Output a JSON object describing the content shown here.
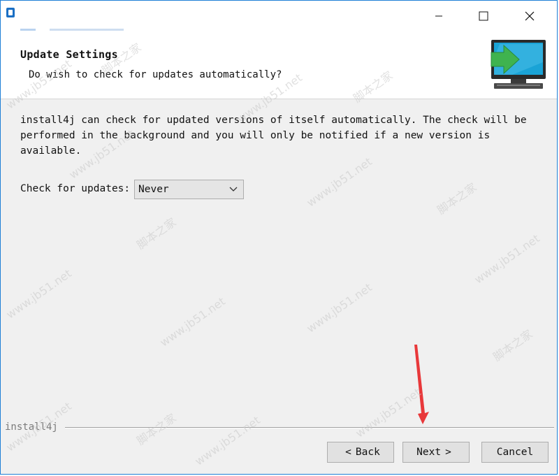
{
  "window": {
    "controls": {
      "minimize_icon": "minimize-icon",
      "maximize_icon": "maximize-icon",
      "close_icon": "close-icon"
    }
  },
  "header": {
    "title": "Update Settings",
    "subtitle": "Do wish to check for updates automatically?",
    "icon": "monitor-arrow-icon"
  },
  "content": {
    "description": "install4j can check for updated versions of itself automatically. The check will be performed in the background and you will only be notified if a new version is available.",
    "check_label": "Check for updates:",
    "check_select": {
      "value": "Never",
      "icon": "chevron-down-icon"
    }
  },
  "footer": {
    "group_label": "install4j"
  },
  "buttons": {
    "back_arrow": "<",
    "back": "Back",
    "next": "Next",
    "next_arrow": ">",
    "cancel": "Cancel"
  },
  "annotation": {
    "arrow_color": "#e8383a"
  },
  "watermark": {
    "site": "www.jb51.net",
    "brand": "脚本之家"
  },
  "colors": {
    "accent": "#1e7fd6",
    "arrow_green": "#3fb34f",
    "screen_blue": "#1aa3d6"
  }
}
